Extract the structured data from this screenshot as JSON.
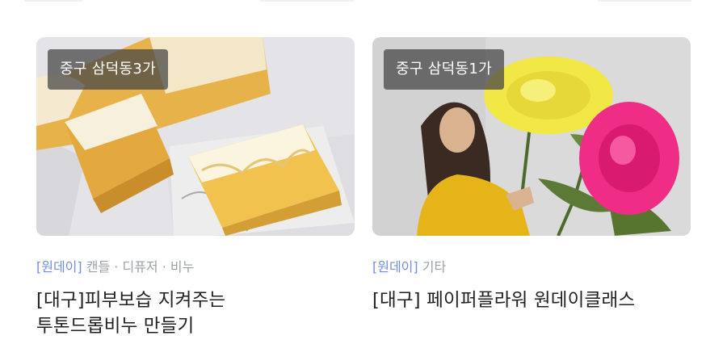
{
  "cards": [
    {
      "location": "중구 삼덕동3가",
      "tag": "[원데이]",
      "category": "캔들 · 디퓨저 · 비누",
      "title_line1": "[대구]피부보습 지켜주는",
      "title_line2": "투톤드롭비누 만들기"
    },
    {
      "location": "중구 삼덕동1가",
      "tag": "[원데이]",
      "category": "기타",
      "title_line1": "[대구] 페이퍼플라워 원데이클래스",
      "title_line2": ""
    }
  ]
}
